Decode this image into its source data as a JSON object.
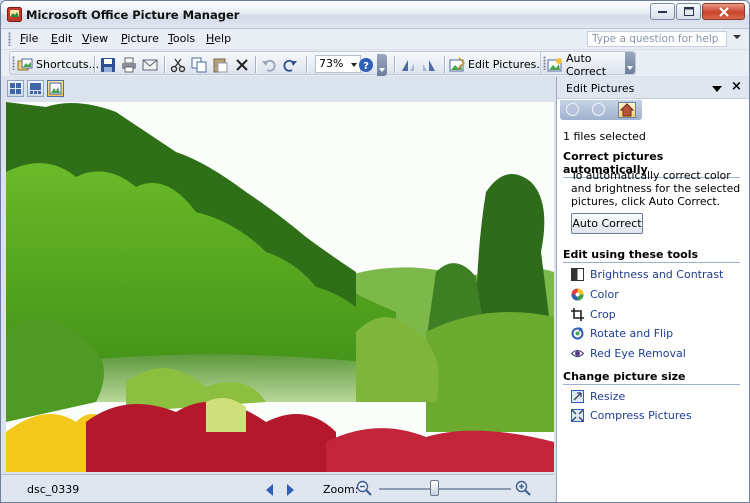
{
  "window": {
    "title": "Microsoft Office Picture Manager"
  },
  "menu": {
    "items": [
      "File",
      "Edit",
      "View",
      "Picture",
      "Tools",
      "Help"
    ],
    "help_placeholder": "Type a question for help"
  },
  "toolbar": {
    "shortcuts_label": "Shortcuts...",
    "zoom_value": "73%",
    "edit_pictures_label": "Edit Pictures...",
    "auto_correct_label": "Auto Correct"
  },
  "status": {
    "filename": "dsc_0339",
    "zoom_label": "Zoom:",
    "zoom_level": 0.42
  },
  "pane": {
    "title": "Edit Pictures",
    "files_selected": "1 files selected",
    "section_auto": "Correct pictures automatically",
    "auto_text": "To automatically correct color and brightness for the selected pictures, click Auto Correct.",
    "auto_button": "Auto Correct",
    "section_tools": "Edit using these tools",
    "tools": [
      "Brightness and Contrast",
      "Color",
      "Crop",
      "Rotate and Flip",
      "Red Eye Removal"
    ],
    "section_size": "Change picture size",
    "size_tools": [
      "Resize",
      "Compress Pictures"
    ]
  },
  "colors": {
    "link": "#1f3d92",
    "close_button": "#c9452c"
  }
}
